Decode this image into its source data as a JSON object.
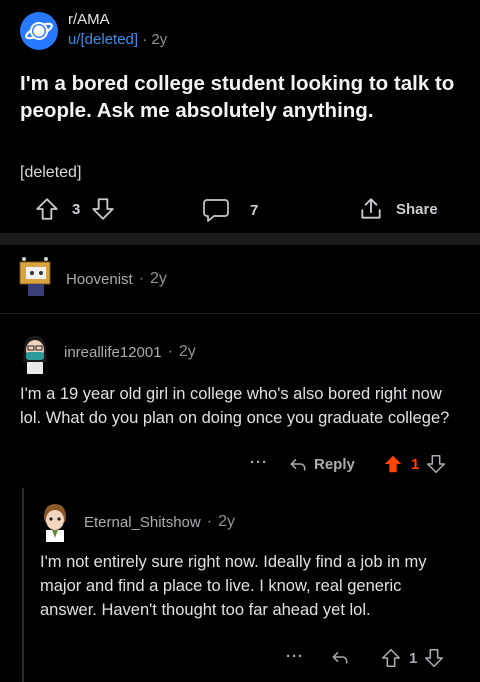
{
  "post": {
    "subreddit": "r/AMA",
    "author": "u/[deleted]",
    "separator": "·",
    "age": "2y",
    "title": "I'm a bored college student looking to talk to people. Ask me absolutely anything.",
    "body": "[deleted]",
    "score": "3",
    "comment_count": "7",
    "share_label": "Share"
  },
  "comments": [
    {
      "author": "Hoovenist",
      "separator": "·",
      "age": "2y"
    },
    {
      "author": "inreallife12001",
      "separator": "·",
      "age": "2y",
      "text": "I'm a 19 year old girl in college who's also bored right now lol. What do you plan on doing once you graduate college?",
      "more": "···",
      "reply_label": "Reply",
      "score": "1"
    },
    {
      "author": "Eternal_Shitshow",
      "separator": "·",
      "age": "2y",
      "text": "I'm not entirely sure right now. Ideally find a job in my major and find a place to live. I know, real generic answer. Haven't thought too far ahead yet lol.",
      "more": "···",
      "score": "1"
    }
  ],
  "colors": {
    "background": "#000000",
    "upvoted": "#ff4500",
    "username_link": "#3b8fe6"
  }
}
